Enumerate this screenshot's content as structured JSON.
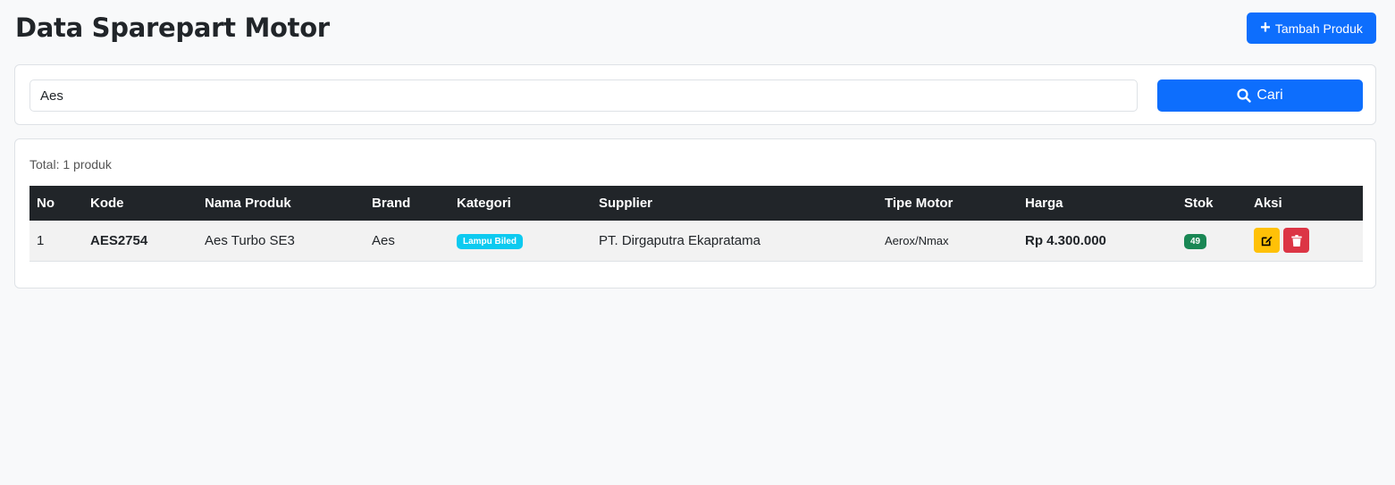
{
  "header": {
    "title": "Data Sparepart Motor",
    "add_label": "Tambah Produk"
  },
  "search": {
    "value": "Aes",
    "button_label": "Cari"
  },
  "summary": {
    "total_label": "Total: 1 produk"
  },
  "table": {
    "columns": [
      "No",
      "Kode",
      "Nama Produk",
      "Brand",
      "Kategori",
      "Supplier",
      "Tipe Motor",
      "Harga",
      "Stok",
      "Aksi"
    ],
    "rows": [
      {
        "no": "1",
        "kode": "AES2754",
        "nama": "Aes Turbo SE3",
        "brand": "Aes",
        "kategori": "Lampu Biled",
        "supplier": "PT. Dirgaputra Ekapratama",
        "tipe": "Aerox/Nmax",
        "harga": "Rp 4.300.000",
        "stok": "49"
      }
    ]
  },
  "colors": {
    "primary": "#0d6efd",
    "dark": "#212529",
    "info": "#0dcaf0",
    "success": "#198754",
    "warning": "#ffc107",
    "danger": "#dc3545"
  },
  "icons": {
    "add": "plus-icon",
    "search": "search-icon",
    "edit": "edit-icon",
    "delete": "trash-icon"
  }
}
